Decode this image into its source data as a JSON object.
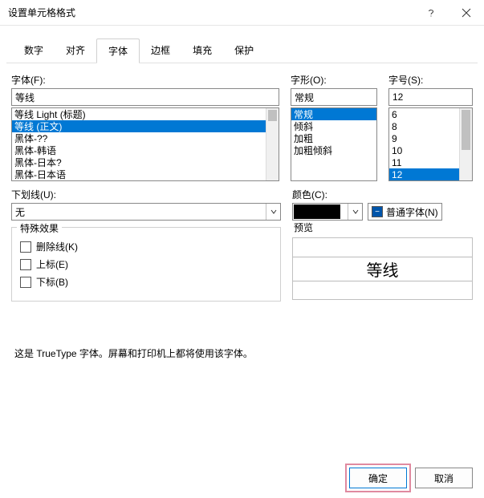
{
  "window": {
    "title": "设置单元格格式"
  },
  "tabs": [
    "数字",
    "对齐",
    "字体",
    "边框",
    "填充",
    "保护"
  ],
  "activeTab": 2,
  "font": {
    "label": "字体(F):",
    "value": "等线",
    "items": [
      "等线 Light (标题)",
      "等线 (正文)",
      "黑体-??",
      "黑体-韩语",
      "黑体-日本?",
      "黑体-日本语"
    ],
    "selectedIndex": 1
  },
  "style": {
    "label": "字形(O):",
    "value": "常规",
    "items": [
      "常规",
      "倾斜",
      "加粗",
      "加粗倾斜"
    ],
    "selectedIndex": 0
  },
  "size": {
    "label": "字号(S):",
    "value": "12",
    "items": [
      "6",
      "8",
      "9",
      "10",
      "11",
      "12"
    ],
    "selectedIndex": 5
  },
  "underline": {
    "label": "下划线(U):",
    "value": "无"
  },
  "color": {
    "label": "颜色(C):",
    "normalFont": "普通字体(N)",
    "value": "#000000",
    "normalFontChecked": true
  },
  "effects": {
    "legend": "特殊效果",
    "strike": "删除线(K)",
    "super": "上标(E)",
    "sub": "下标(B)"
  },
  "preview": {
    "label": "预览",
    "sample": "等线"
  },
  "description": "这是 TrueType 字体。屏幕和打印机上都将使用该字体。",
  "buttons": {
    "ok": "确定",
    "cancel": "取消"
  }
}
